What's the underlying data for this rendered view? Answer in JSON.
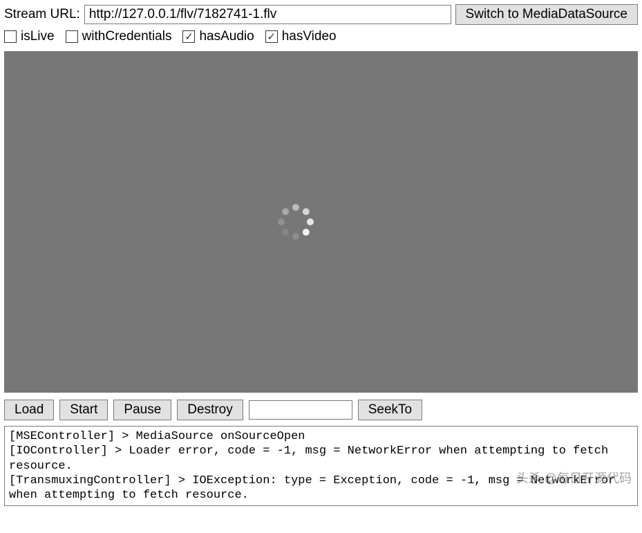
{
  "url_row": {
    "label": "Stream URL:",
    "value": "http://127.0.0.1/flv/7182741-1.flv",
    "switch_button": "Switch to MediaDataSource"
  },
  "options": {
    "isLive": {
      "label": "isLive",
      "checked": false
    },
    "withCredentials": {
      "label": "withCredentials",
      "checked": false
    },
    "hasAudio": {
      "label": "hasAudio",
      "checked": true
    },
    "hasVideo": {
      "label": "hasVideo",
      "checked": true
    }
  },
  "controls": {
    "load": "Load",
    "start": "Start",
    "pause": "Pause",
    "destroy": "Destroy",
    "seek_value": "",
    "seekto": "SeekTo"
  },
  "log": {
    "lines": [
      "[MSEController] > MediaSource onSourceOpen",
      "[IOController] > Loader error, code = -1, msg = NetworkError when attempting to fetch resource.",
      "[TransmuxingController] > IOException: type = Exception, code = -1, msg = NetworkError when attempting to fetch resource."
    ]
  },
  "watermark": "头杀 @每日开源代码",
  "checkmark_glyph": "✓"
}
